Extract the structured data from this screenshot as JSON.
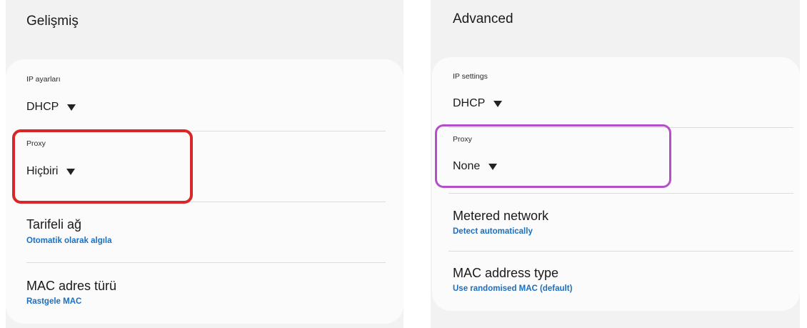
{
  "colors": {
    "panel_bg": "#f2f2f2",
    "card_bg": "#fbfbfb",
    "link_blue": "#1a6fc2",
    "highlight_left": "#d62828",
    "highlight_right": "#b54fc9"
  },
  "left": {
    "section_title": "Gelişmiş",
    "ip_label": "IP ayarları",
    "ip_value": "DHCP",
    "proxy_label": "Proxy",
    "proxy_value": "Hiçbiri",
    "metered_title": "Tarifeli ağ",
    "metered_value": "Otomatik olarak algıla",
    "mac_title": "MAC adres türü",
    "mac_value": "Rastgele MAC"
  },
  "right": {
    "section_title": "Advanced",
    "ip_label": "IP settings",
    "ip_value": "DHCP",
    "proxy_label": "Proxy",
    "proxy_value": "None",
    "metered_title": "Metered network",
    "metered_value": "Detect automatically",
    "mac_title": "MAC address type",
    "mac_value": "Use randomised MAC (default)"
  },
  "icons": {
    "dropdown": "caret-down-icon"
  }
}
